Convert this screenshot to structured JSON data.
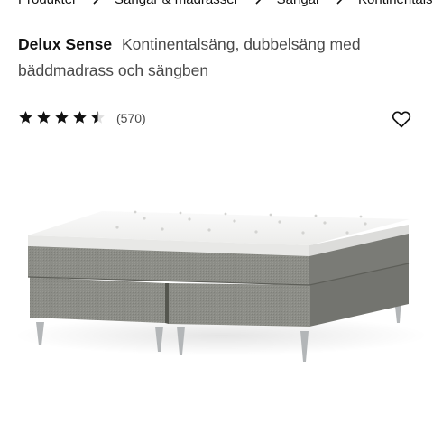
{
  "breadcrumb": {
    "items": [
      {
        "label": "Produkter"
      },
      {
        "label": "Sängar & madrasser"
      },
      {
        "label": "Sängar"
      },
      {
        "label": "Kontinentalsängar"
      }
    ]
  },
  "product": {
    "name": "Delux Sense",
    "description": "Kontinentalsäng, dubbelsäng med bäddmadrass och sängben"
  },
  "rating": {
    "value": 4.5,
    "max": 5,
    "count_label": "(570)"
  },
  "icons": {
    "favorite": "heart-outline-icon",
    "breadcrumb_separator": "chevron-right-icon",
    "star": "star-icon"
  },
  "colors": {
    "text": "#111111",
    "secondary_text": "#484848",
    "background": "#ffffff",
    "bed_fabric": "#8a8b85",
    "topper": "#f4f4f2"
  }
}
